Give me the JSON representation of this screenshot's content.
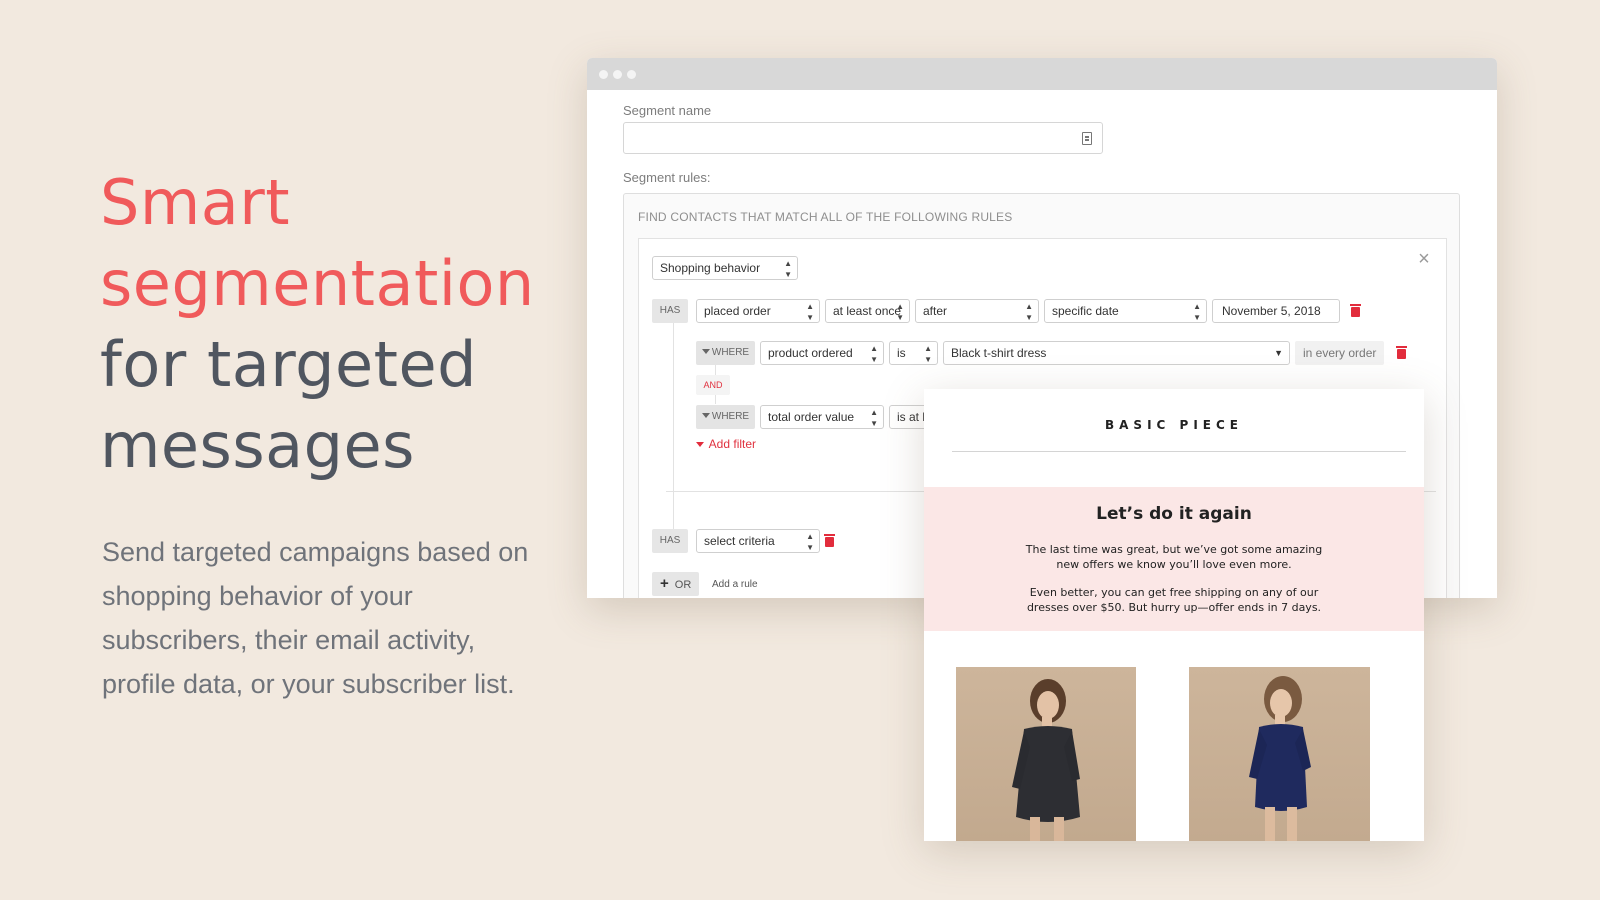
{
  "hero": {
    "headline_line1": "Smart",
    "headline_line2": "segmentation",
    "headline_line3": "for targeted",
    "headline_line4": "messages",
    "description": "Send targeted campaigns based on shopping behavior of your subscribers, their email activity, profile data, or your subscriber list."
  },
  "colors": {
    "accent": "#f05a5b",
    "headline_dark": "#505660",
    "background": "#f2e9df",
    "danger": "#e22c3c",
    "email_banner": "#fbe7e6"
  },
  "segment": {
    "name_label": "Segment name",
    "name_value": "",
    "name_icon": "contact-card-icon",
    "rules_label": "Segment rules:",
    "find_text": "FIND CONTACTS THAT MATCH ALL OF THE FOLLOWING RULES",
    "category": "Shopping behavior",
    "rule1": {
      "has": "HAS",
      "action": "placed order",
      "frequency": "at least once",
      "time_relation": "after",
      "date_type": "specific date",
      "date": "November 5, 2018"
    },
    "filter1": {
      "where": "WHERE",
      "field": "product ordered",
      "operator": "is",
      "value": "Black t-shirt dress",
      "suffix": "in every order"
    },
    "and_label": "AND",
    "filter2": {
      "where": "WHERE",
      "field": "total order value",
      "operator": "is at l"
    },
    "add_filter": "Add filter",
    "rule2": {
      "has": "HAS",
      "criteria": "select criteria"
    },
    "or_label": "OR",
    "add_rule": "Add a rule"
  },
  "email": {
    "brand": "BASIC PIECE",
    "heading": "Let’s do it again",
    "para1": "The last time was great, but we’ve got some amazing new offers we know you’ll love even more.",
    "para2": "Even better, you can get free shipping on any of our dresses over $50. But hurry up—offer ends in 7 days."
  }
}
